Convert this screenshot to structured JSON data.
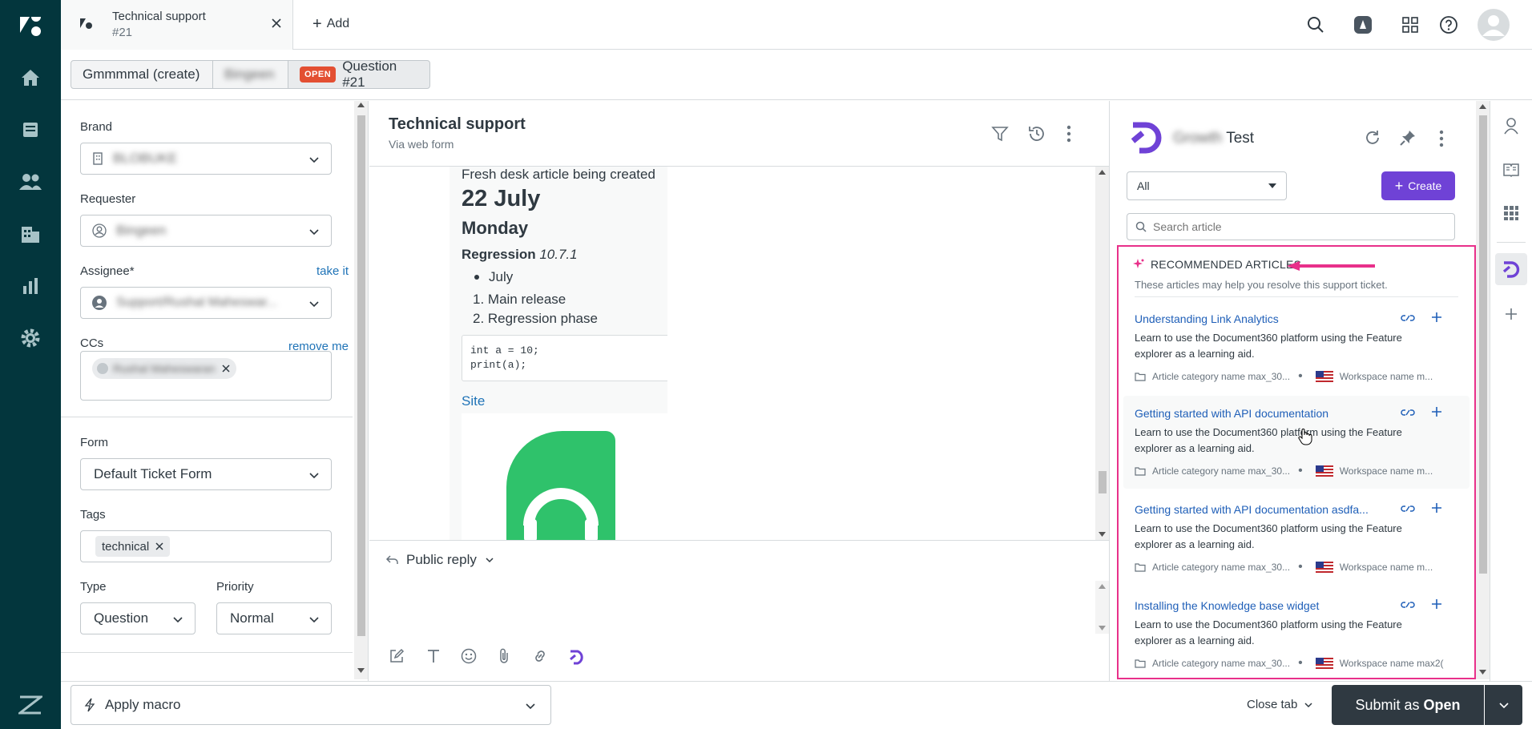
{
  "topbar": {
    "tab_title": "Technical support",
    "tab_number": "#21",
    "add_label": "Add"
  },
  "breadcrumbs": {
    "org": "Gmmmmal (create)",
    "user": "Bingeen",
    "status_badge": "OPEN",
    "ticket": "Question #21"
  },
  "properties": {
    "brand_label": "Brand",
    "brand_value": "BLOBUKE",
    "requester_label": "Requester",
    "requester_value": "Bingeen",
    "assignee_label": "Assignee*",
    "take_it": "take it",
    "assignee_value": "Support/Rushal Maheswar...",
    "ccs_label": "CCs",
    "remove_me": "remove me",
    "cc_value": "Rushal Maheswaran",
    "form_label": "Form",
    "form_value": "Default Ticket Form",
    "tags_label": "Tags",
    "tag_value": "technical",
    "type_label": "Type",
    "type_value": "Question",
    "priority_label": "Priority",
    "priority_value": "Normal"
  },
  "conversation": {
    "title": "Technical support",
    "subtitle": "Via web form",
    "article_line": "Fresh desk article being created",
    "date_heading": "22 July",
    "day_heading": "Monday",
    "regression_bold": "Regression",
    "regression_version": "10.7.1",
    "bullet_item": "July",
    "numbered_items": [
      "Main release",
      "Regression phase"
    ],
    "code_line1": "int a = 10;",
    "code_line2": "print(a);",
    "site_link": "Site",
    "reply_mode": "Public reply"
  },
  "footer": {
    "macro_label": "Apply macro",
    "close_tab": "Close tab",
    "submit_prefix": "Submit as ",
    "submit_status": "Open"
  },
  "app": {
    "title_blurred": "Growth",
    "title_suffix": "Test",
    "filter_value": "All",
    "create_label": "Create",
    "search_placeholder": "Search article",
    "rec_heading": "RECOMMENDED ARTICLES",
    "rec_subtitle": "These articles may help you resolve this support ticket.",
    "accent_color": "#6f42d6",
    "highlight_color": "#e8308a",
    "articles": [
      {
        "title": "Understanding Link Analytics",
        "desc": "Learn to use the Document360 platform using the Feature explorer as a learning aid.",
        "category": "Article category name max_30...",
        "workspace": "Workspace name m..."
      },
      {
        "title": "Getting started with API documentation",
        "desc": "Learn to use the Document360 platform using the Feature explorer as a learning aid.",
        "category": "Article category name max_30...",
        "workspace": "Workspace name m..."
      },
      {
        "title": "Getting started with API documentation asdfa...",
        "desc": "Learn to use the Document360 platform using the Feature explorer as a learning aid.",
        "category": "Article category name max_30...",
        "workspace": "Workspace name m..."
      },
      {
        "title": "Installing the Knowledge base widget",
        "desc": "Learn to use the Document360 platform using the Feature explorer as a learning aid.",
        "category": "Article category name max_30...",
        "workspace": "Workspace name max2("
      }
    ]
  }
}
